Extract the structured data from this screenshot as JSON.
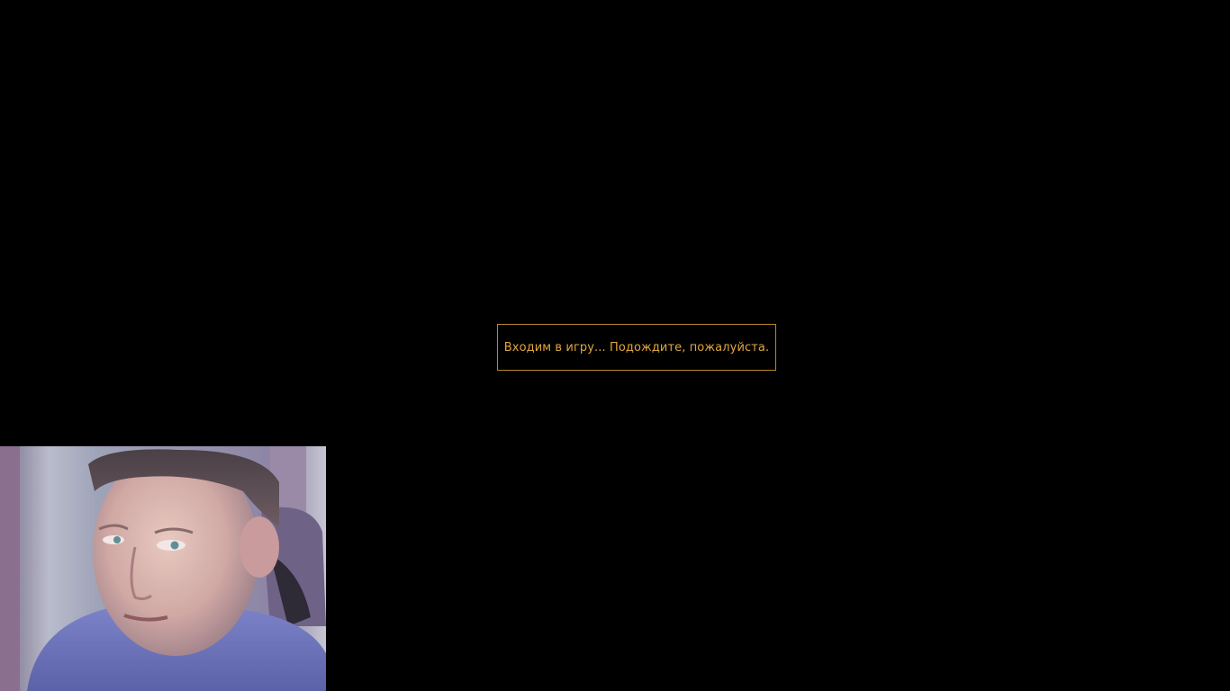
{
  "loading": {
    "message": "Входим в игру... Подождите, пожалуйста.",
    "text_color": "#e0a640",
    "border_color": "#b8862b"
  },
  "background_color": "#000000",
  "webcam_overlay": {
    "content": "streamer-webcam-feed"
  }
}
